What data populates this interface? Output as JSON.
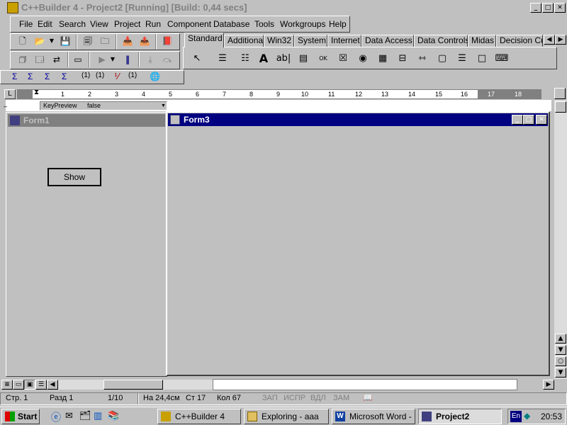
{
  "app": {
    "title": "C++Builder 4 - Project2 [Running] [Build: 0,44 secs]",
    "title_buttons": [
      "_",
      "□",
      "✕"
    ]
  },
  "menu": [
    "File",
    "Edit",
    "Search",
    "View",
    "Project",
    "Run",
    "Component",
    "Database",
    "Tools",
    "Workgroups",
    "Help"
  ],
  "palette_tabs": [
    "Standard",
    "Additional",
    "Win32",
    "System",
    "Internet",
    "Data Access",
    "Data Controls",
    "Midas",
    "Decision Cub"
  ],
  "palette_active": "Standard",
  "formula_bar": {
    "symbols": [
      "Σ",
      "Σ",
      "Σ",
      "Σ",
      "(1)",
      "(1)",
      "(1)"
    ]
  },
  "ruler": {
    "numbers": [
      "1",
      "2",
      "3",
      "4",
      "5",
      "6",
      "7",
      "8",
      "9",
      "10",
      "11",
      "12",
      "13",
      "14",
      "15",
      "16",
      "17",
      "18"
    ]
  },
  "inspector_row": {
    "property": "KeyPreview",
    "value": "false"
  },
  "form1": {
    "title": "Form1",
    "button_label": "Show"
  },
  "form3": {
    "title": "Form3"
  },
  "statusbar": {
    "page": "Стр. 1",
    "section": "Разд 1",
    "pages": "1/10",
    "at": "На 24,4см",
    "line": "Ст 17",
    "col": "Кол 67",
    "indicators": [
      "ЗАП",
      "ИСПР",
      "ВДЛ",
      "ЗАМ"
    ]
  },
  "taskbar": {
    "start": "Start",
    "tasks": [
      "C++Builder 4",
      "Exploring - aaa",
      "Microsoft Word - ...",
      "Project2"
    ],
    "active_task": "Project2",
    "lang": "En",
    "clock": "20:53"
  },
  "colors": {
    "face": "#c0c0c0",
    "active_title": "#000080",
    "inactive_title": "#808080"
  }
}
